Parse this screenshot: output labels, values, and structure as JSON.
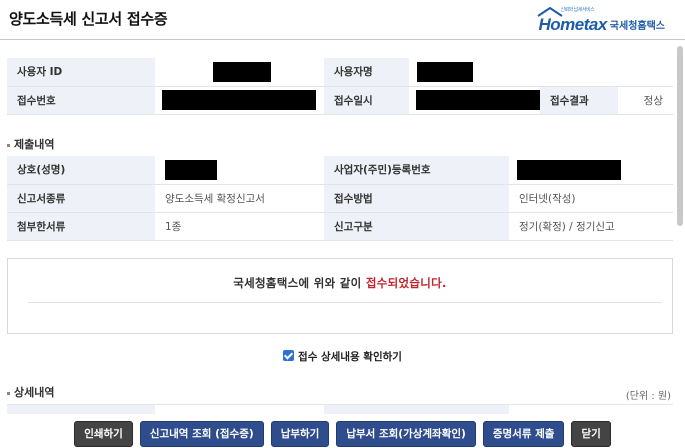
{
  "header": {
    "title": "양도소득세 신고서 접수증",
    "logo_text": "국세청홈택스",
    "logo_mark": "Hometax",
    "logo_small": "신뢰와 납세서비스"
  },
  "user": {
    "user_id_label": "사용자 ID",
    "user_name_label": "사용자명",
    "receipt_no_label": "접수번호",
    "receipt_datetime_label": "접수일시",
    "receipt_result_label": "접수결과",
    "receipt_result_value": "정상"
  },
  "submission": {
    "section_title": "제출내역",
    "business_name_label": "상호(성명)",
    "reg_no_label": "사업자(주민)등록번호",
    "return_type_label": "신고서종류",
    "return_type_value": "양도소득세 확정신고서",
    "method_label": "접수방법",
    "method_value": "인터넷(작성)",
    "attachments_label": "첨부한서류",
    "attachments_value": "1종",
    "category_label": "신고구분",
    "category_value": "정기(확정) / 정기신고"
  },
  "notice": {
    "prefix": "국세청홈택스에 위와 같이 ",
    "highlight": "접수되었습니다."
  },
  "detail_check": {
    "label": "접수 상세내용 확인하기",
    "checked": true
  },
  "details": {
    "section_title": "상세내역",
    "unit": "(단위 : 원)"
  },
  "buttons": {
    "print": "인쇄하기",
    "history": "신고내역 조회 (접수증)",
    "pay": "납부하기",
    "bill_lookup": "납부서 조회(가상계좌확인)",
    "submit_docs": "증명서류 제출",
    "close": "닫기"
  },
  "colors": {
    "label_bg": "#eef1f7",
    "accent_red": "#c0262c",
    "button_dark": "#444444",
    "button_blue": "#2f4d8c"
  }
}
